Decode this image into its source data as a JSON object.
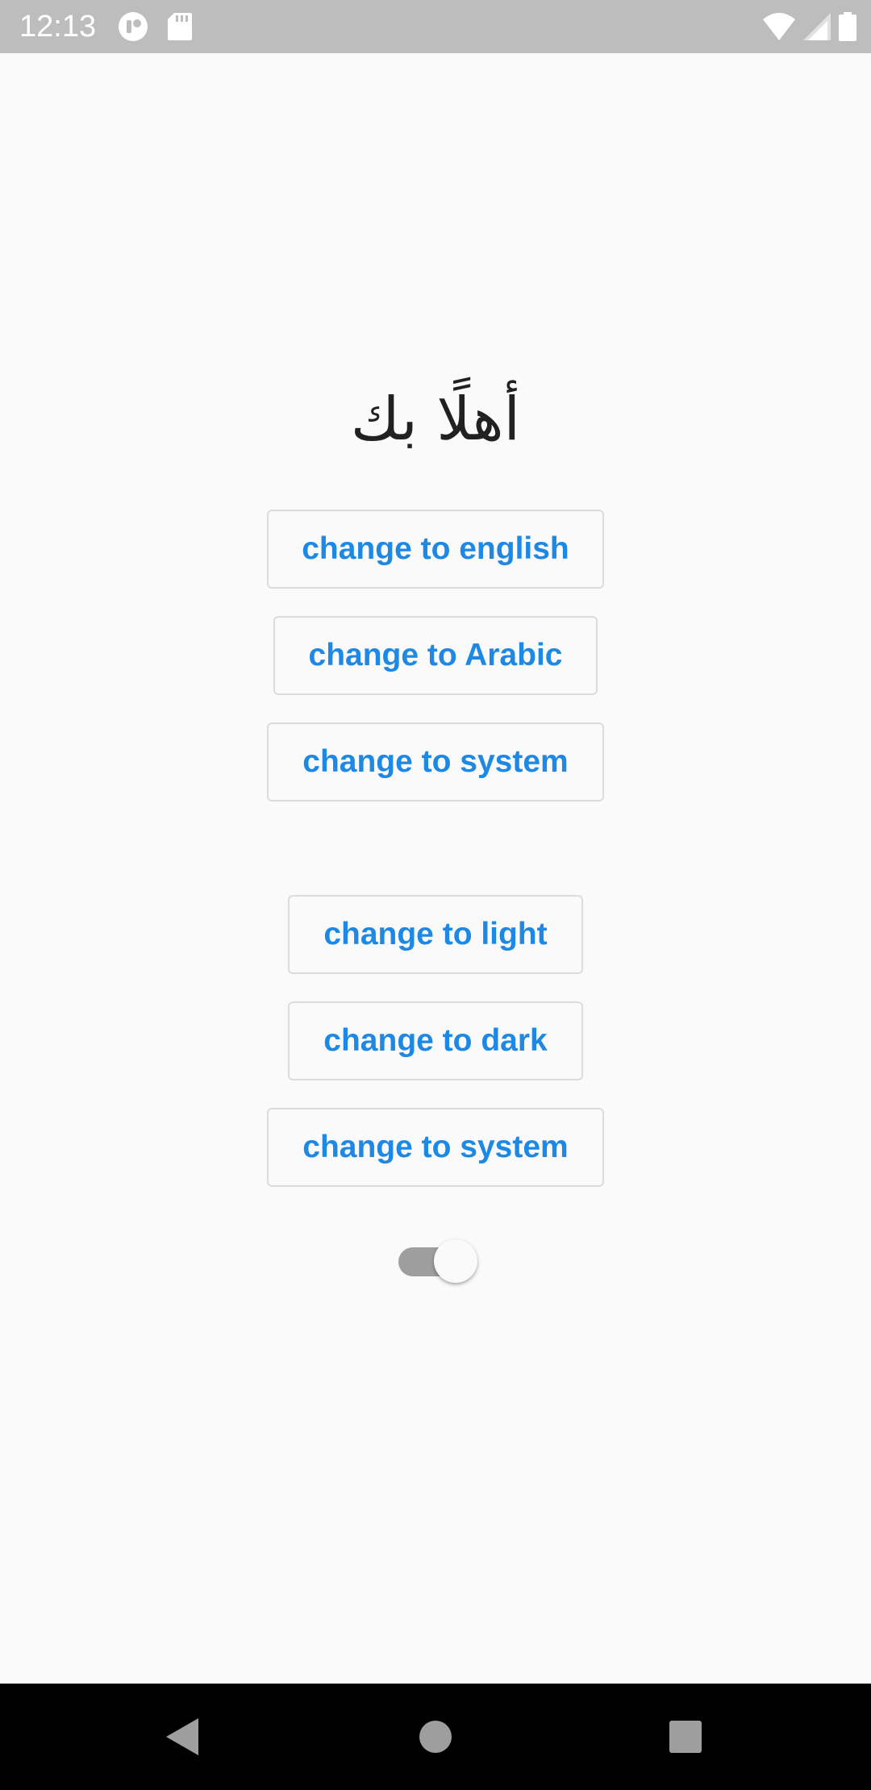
{
  "status_bar": {
    "time": "12:13",
    "left_icons": [
      "notification-app-icon",
      "sd-card-icon"
    ],
    "right_icons": [
      "wifi-icon",
      "cell-signal-icon",
      "battery-icon"
    ]
  },
  "main": {
    "greeting": "أهلًا بك",
    "language_buttons": [
      "change to english",
      "change to Arabic",
      "change to system"
    ],
    "theme_buttons": [
      "change to light",
      "change to dark",
      "change to system"
    ],
    "theme_switch": {
      "on": true
    }
  },
  "nav_bar": {
    "buttons": [
      "back-icon",
      "home-icon",
      "recents-icon"
    ]
  },
  "colors": {
    "accent": "#1e88e5",
    "background": "#fafafa",
    "status_bar": "#bdbdbd",
    "button_border": "#dcdcdc",
    "nav_bar": "#000000"
  }
}
